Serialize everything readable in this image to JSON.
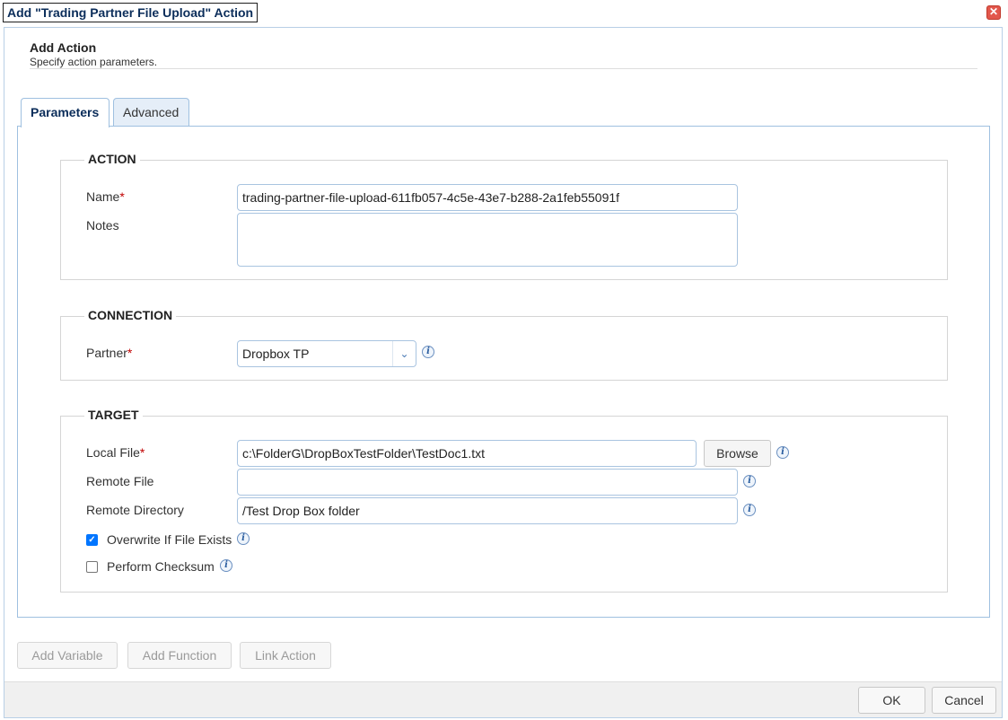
{
  "dialog": {
    "title": "Add \"Trading Partner File Upload\" Action",
    "close_glyph": "✕"
  },
  "header": {
    "title": "Add Action",
    "subtitle": "Specify action parameters."
  },
  "tabs": [
    {
      "label": "Parameters",
      "active": true
    },
    {
      "label": "Advanced",
      "active": false
    }
  ],
  "action_section": {
    "legend": "ACTION",
    "name_label": "Name",
    "name_value": "trading-partner-file-upload-611fb057-4c5e-43e7-b288-2a1feb55091f",
    "notes_label": "Notes",
    "notes_value": ""
  },
  "connection_section": {
    "legend": "CONNECTION",
    "partner_label": "Partner",
    "partner_value": "Dropbox TP"
  },
  "target_section": {
    "legend": "TARGET",
    "local_file_label": "Local File",
    "local_file_value": "c:\\FolderG\\DropBoxTestFolder\\TestDoc1.txt",
    "browse_label": "Browse",
    "remote_file_label": "Remote File",
    "remote_file_value": "",
    "remote_directory_label": "Remote Directory",
    "remote_directory_value": "/Test Drop Box folder",
    "overwrite_label": "Overwrite If File Exists",
    "overwrite_checked": true,
    "checksum_label": "Perform Checksum",
    "checksum_checked": false
  },
  "required_marker": "*",
  "info_glyph": "i",
  "check_glyph": "✓",
  "chevron_glyph": "⌄",
  "toolbar": {
    "add_variable": "Add Variable",
    "add_function": "Add Function",
    "link_action": "Link Action"
  },
  "footer": {
    "ok": "OK",
    "cancel": "Cancel"
  },
  "colors": {
    "accent": "#0b2d5a",
    "border": "#9fc0e0",
    "required": "#c00000",
    "checkbox": "#0075ff"
  },
  "icons": [
    "close-icon",
    "info-icon",
    "chevron-down-icon",
    "check-icon"
  ]
}
